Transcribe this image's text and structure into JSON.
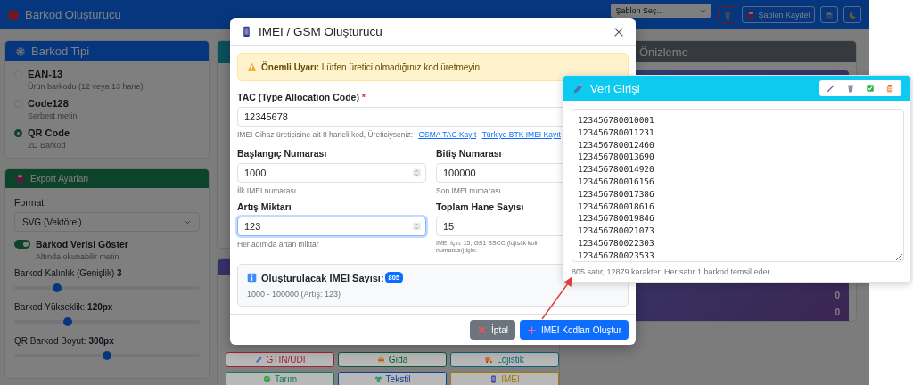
{
  "app": {
    "title": "Barkod Oluşturucu",
    "template_select": "Şablon Seç...",
    "header_buttons": [
      {
        "kind": "trash"
      },
      {
        "kind": "save",
        "label": "Şablon Kaydet"
      },
      {
        "kind": "refresh"
      },
      {
        "kind": "moon"
      }
    ]
  },
  "barcode_type": {
    "title": "Barkod Tipi",
    "options": [
      {
        "name": "EAN-13",
        "description": "Ürün barkodu (12 veya 13 hane)",
        "selected": false
      },
      {
        "name": "Code128",
        "description": "Serbest metin",
        "selected": false
      },
      {
        "name": "QR Code",
        "description": "2D Barkod",
        "selected": true
      }
    ]
  },
  "export": {
    "title": "Export Ayarları",
    "format_label": "Format",
    "format": "SVG (Vektörel)",
    "toggle": {
      "label": "Barkod Verisi Göster",
      "description": "Altında okunabilir metin",
      "on": true
    },
    "sliders": [
      {
        "label": "Barkod Kalınlık (Genişlik) **3**",
        "level": 0.23
      },
      {
        "label": "Barkod Yükseklik: **120px**",
        "level": 0.29
      },
      {
        "label": "QR Barkod Boyut: **300px**",
        "level": 0.5
      }
    ]
  },
  "templates": [
    {
      "kind": "pencil",
      "label": "GTIN/UDI",
      "color": "#a0242f"
    },
    {
      "kind": "burger",
      "label": "Gıda",
      "color": "#0c5a36"
    },
    {
      "kind": "truck",
      "label": "Lojistik",
      "color": "#086577"
    },
    {
      "kind": "globe",
      "label": "Tarım",
      "color": "#0f7a5c"
    },
    {
      "kind": "shirt",
      "label": "Tekstil",
      "color": "#0a3f95"
    },
    {
      "kind": "phone",
      "label": "IMEI",
      "color": "#a07a04"
    }
  ],
  "preview": {
    "title": "Önizleme",
    "stat_values": [
      "0",
      "0"
    ]
  },
  "imei_modal": {
    "title": "IMEI / GSM Oluşturucu",
    "alert": "**Önemli Uyarı:** Lütfen üretici olmadığınız kod üretmeyin.",
    "tac": {
      "label": "TAC (Type Allocation Code)",
      "required_mark": "*",
      "value": "12345678",
      "help": "IMEI Cihaz üreticisine ait 8 haneli kod, Üreticiyseniz:",
      "links": [
        "GSMA TAC Kayıt",
        "Türkiye BTK IMEI Kayıt"
      ]
    },
    "fields": [
      {
        "label": "Başlangıç Numarası",
        "value": "1000",
        "help": "İlk IMEI numarası",
        "stepper": true,
        "focused": false
      },
      {
        "label": "Bitiş Numarası",
        "value": "100000",
        "help": "Son IMEI numarası",
        "stepper": false,
        "focused": false
      },
      {
        "label": "Artış Miktarı",
        "value": "123",
        "help": "Her adımda artan miktar",
        "stepper": true,
        "focused": true
      },
      {
        "label": "Toplam Hane Sayısı",
        "value": "15",
        "help": "IMEI için: 15, GS1 SSCC (lojistik koli numarası) için:",
        "stepper": false,
        "focused": false
      }
    ],
    "summary": {
      "title": "Oluşturulacak IMEI Sayısı:",
      "count": "805",
      "detail": "1000 - 100000 (Artış: 123)"
    },
    "cancel": "İptal",
    "submit": "IMEI Kodları Oluştur"
  },
  "data_entry": {
    "title": "Veri Girişi",
    "tools": [
      {
        "kind": "wand"
      },
      {
        "kind": "trash"
      },
      {
        "kind": "check"
      },
      {
        "kind": "clipboard"
      }
    ],
    "lines": [
      "123456780010001",
      "123456780011231",
      "123456780012460",
      "123456780013690",
      "123456780014920",
      "123456780016156",
      "123456780017386",
      "123456780018616",
      "123456780019846",
      "123456780021073",
      "123456780022303",
      "123456780023533"
    ],
    "footer": "805 satır, 12879 karakter. Her satır 1 barkod temsil eder"
  }
}
